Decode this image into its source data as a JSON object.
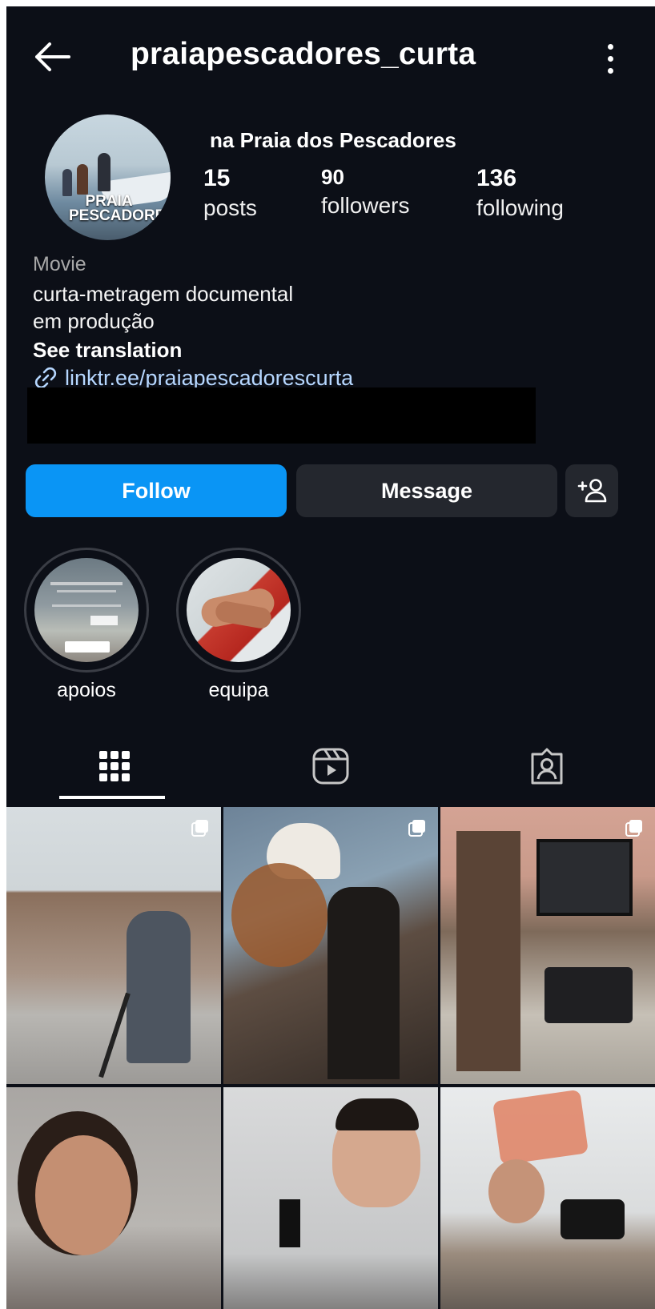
{
  "header": {
    "username": "praiapescadores_curta",
    "back_icon": "arrow-left-icon",
    "more_icon": "more-vertical-icon"
  },
  "profile": {
    "display_name": "na Praia dos Pescadores",
    "avatar_text": "PRAIA PESCADORES",
    "stats": {
      "posts": {
        "count": "15",
        "label": "posts"
      },
      "followers": {
        "count": "90",
        "label": "followers"
      },
      "following": {
        "count": "136",
        "label": "following"
      }
    },
    "category": "Movie",
    "bio_line1": "curta-metragem documental",
    "bio_line2": "em produção",
    "see_translation": "See translation",
    "link": "linktr.ee/praiapescadorescurta"
  },
  "actions": {
    "follow": "Follow",
    "message": "Message",
    "add_user_icon": "add-user-icon"
  },
  "highlights": [
    {
      "label": "apoios"
    },
    {
      "label": "equipa"
    }
  ],
  "tabs": [
    {
      "name": "grid",
      "icon": "grid-icon",
      "active": true
    },
    {
      "name": "reels",
      "icon": "reels-icon",
      "active": false
    },
    {
      "name": "tagged",
      "icon": "tagged-icon",
      "active": false
    }
  ],
  "colors": {
    "background": "#0c0f17",
    "accent": "#0a95f5",
    "button_secondary": "#24272e",
    "link": "#b6d7ff"
  }
}
